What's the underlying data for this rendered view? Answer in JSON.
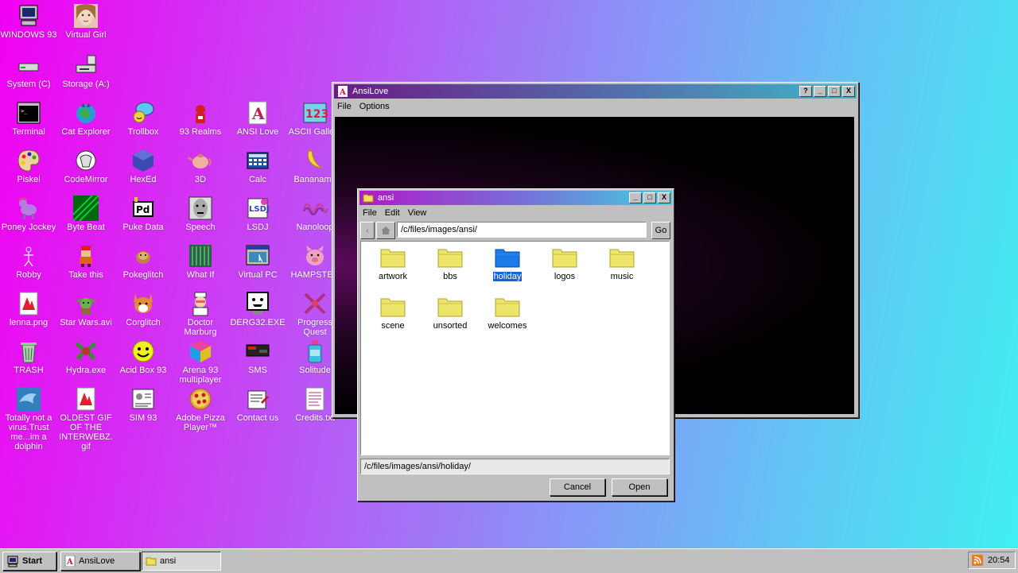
{
  "desktop": {
    "icons": [
      {
        "label": "WINDOWS 93",
        "icon": "computer-icon"
      },
      {
        "label": "Virtual Girl",
        "icon": "girl-face-icon"
      },
      {
        "label": "System (C)",
        "icon": "drive-icon"
      },
      {
        "label": "Storage (A:)",
        "icon": "floppy-drive-icon"
      },
      {
        "label": "Terminal",
        "icon": "terminal-icon"
      },
      {
        "label": "Cat Explorer",
        "icon": "cat-globe-icon"
      },
      {
        "label": "Trollbox",
        "icon": "chat-bubble-icon"
      },
      {
        "label": "93 Realms",
        "icon": "realms-icon"
      },
      {
        "label": "ANSI Love",
        "icon": "ansi-a-icon"
      },
      {
        "label": "ASCII Gallery",
        "icon": "ascii-123-icon"
      },
      {
        "label": "Piskel",
        "icon": "palette-icon"
      },
      {
        "label": "CodeMirror",
        "icon": "codemirror-icon"
      },
      {
        "label": "HexEd",
        "icon": "cube-icon"
      },
      {
        "label": "3D",
        "icon": "teapot-icon"
      },
      {
        "label": "Calc",
        "icon": "calculator-icon"
      },
      {
        "label": "Bananamp",
        "icon": "banana-icon"
      },
      {
        "label": "Poney Jockey",
        "icon": "pony-icon"
      },
      {
        "label": "Byte Beat",
        "icon": "bytebeat-icon"
      },
      {
        "label": "Puke Data",
        "icon": "pd-icon"
      },
      {
        "label": "Speech",
        "icon": "speech-face-icon"
      },
      {
        "label": "LSDJ",
        "icon": "lsdj-icon"
      },
      {
        "label": "Nanoloop",
        "icon": "wave-icon"
      },
      {
        "label": "Robby",
        "icon": "robot-icon"
      },
      {
        "label": "Take this",
        "icon": "pixel-man-icon"
      },
      {
        "label": "Pokeglitch",
        "icon": "pokeglitch-icon"
      },
      {
        "label": "What If",
        "icon": "whatif-icon"
      },
      {
        "label": "Virtual PC",
        "icon": "virtual-pc-icon"
      },
      {
        "label": "HAMPSTER",
        "icon": "pig-icon"
      },
      {
        "label": "lenna.png",
        "icon": "image-file-icon"
      },
      {
        "label": "Star Wars.avi",
        "icon": "yoda-icon"
      },
      {
        "label": "Corglitch",
        "icon": "corgi-icon"
      },
      {
        "label": "Doctor Marburg",
        "icon": "doctor-icon"
      },
      {
        "label": "DERG32.EXE",
        "icon": "monitor-face-icon"
      },
      {
        "label": "Progress Quest",
        "icon": "swords-icon"
      },
      {
        "label": "TRASH",
        "icon": "trash-icon"
      },
      {
        "label": "Hydra.exe",
        "icon": "hydra-icon"
      },
      {
        "label": "Acid Box 93",
        "icon": "smiley-icon"
      },
      {
        "label": "Arena 93 multiplayer",
        "icon": "arena-cube-icon"
      },
      {
        "label": "SMS",
        "icon": "console-icon"
      },
      {
        "label": "Solitude",
        "icon": "bottle-icon"
      },
      {
        "label": "Totally not a virus.Trust me...im a dolphin",
        "icon": "dolphin-icon"
      },
      {
        "label": "OLDEST GIF OF THE INTERWEBZ.gif",
        "icon": "gif-file-icon"
      },
      {
        "label": "SIM 93",
        "icon": "sim-icon"
      },
      {
        "label": "Adobe Pizza Player™",
        "icon": "pizza-icon"
      },
      {
        "label": "Contact us",
        "icon": "contact-icon"
      },
      {
        "label": "Credits.txt",
        "icon": "text-file-icon"
      }
    ]
  },
  "ansilove": {
    "title": "AnsiLove",
    "menu": [
      "File",
      "Options"
    ],
    "buttons": {
      "help": "?",
      "minimize": "_",
      "maximize": "□",
      "close": "X"
    }
  },
  "dialog": {
    "title": "ansi",
    "menu": [
      "File",
      "Edit",
      "View"
    ],
    "path": "/c/files/images/ansi/",
    "go_label": "Go",
    "folders": [
      "artwork",
      "bbs",
      "holiday",
      "logos",
      "music",
      "scene",
      "unsorted",
      "welcomes"
    ],
    "selected": "holiday",
    "selected_path": "/c/files/images/ansi/holiday/",
    "cancel_label": "Cancel",
    "open_label": "Open"
  },
  "taskbar": {
    "start_label": "Start",
    "tasks": [
      "AnsiLove",
      "ansi"
    ],
    "clock": "20:54"
  },
  "colors": {
    "selection": "#1565d8",
    "title_gradient_start": "#6b1a88",
    "title_gradient_end": "#3fb5c9"
  }
}
